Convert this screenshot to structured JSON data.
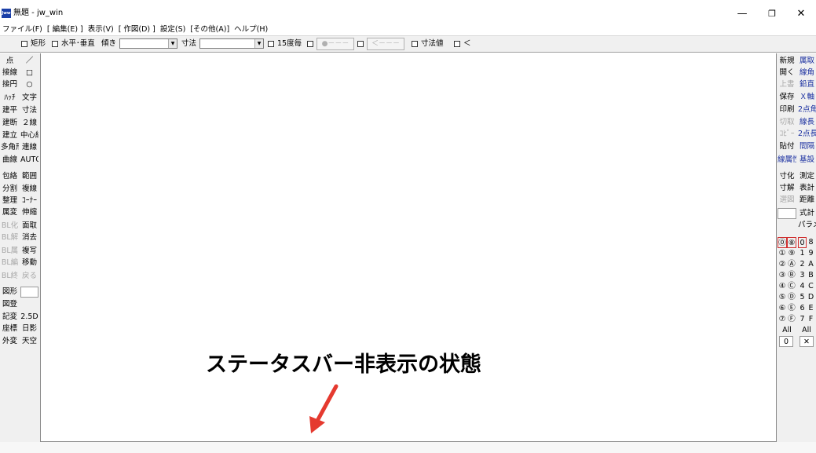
{
  "window": {
    "app_icon_text": "Jww",
    "title": "無題 - jw_win",
    "controls": {
      "minimize": "—",
      "maximize": "❐",
      "close": "✕"
    }
  },
  "menu": [
    "ファイル(F)",
    "[ 編集(E) ]",
    "表示(V)",
    "[ 作図(D) ]",
    "設定(S)",
    "[その他(A)]",
    "ヘルプ(H)"
  ],
  "toolbar": {
    "rect": "矩形",
    "horiz_vert": "水平･垂直",
    "angle_label": "傾き",
    "angle_value": "",
    "dim_label": "寸法",
    "dim_value": "",
    "deg15": "15度毎",
    "btn1": "●－－－",
    "btn2": "＜－－－",
    "dim_value_label": "寸法値",
    "last": "＜"
  },
  "left_tools": [
    [
      "点",
      "／"
    ],
    [
      "接線",
      "□"
    ],
    [
      "接円",
      "○"
    ],
    [
      "ﾊｯﾁ",
      "文字"
    ],
    [
      "建平",
      "寸法"
    ],
    [
      "建断",
      "２線"
    ],
    [
      "建立",
      "中心線"
    ],
    [
      "多角形",
      "連線"
    ],
    [
      "曲線",
      "AUTO"
    ],
    [
      "包絡",
      "範囲"
    ],
    [
      "分割",
      "複線"
    ],
    [
      "整理",
      "ｺｰﾅｰ"
    ],
    [
      "属変",
      "伸縮"
    ],
    [
      "BL化",
      "面取"
    ],
    [
      "BL解",
      "消去"
    ],
    [
      "BL属",
      "複写"
    ],
    [
      "BL編",
      "移動"
    ],
    [
      "BL終",
      "戻る"
    ],
    [
      "図形",
      ""
    ],
    [
      "図登",
      ""
    ],
    [
      "記変",
      "2.5D"
    ],
    [
      "座標",
      "日影"
    ],
    [
      "外変",
      "天空"
    ]
  ],
  "right_tools": [
    [
      "新規",
      "属取"
    ],
    [
      "開く",
      "線角"
    ],
    [
      "上書",
      "鉛直"
    ],
    [
      "保存",
      "Ｘ軸"
    ],
    [
      "印刷",
      "2点角"
    ],
    [
      "切取",
      "線長"
    ],
    [
      "ｺﾋﾟｰ",
      "2点長"
    ],
    [
      "貼付",
      "間隔"
    ],
    [
      "線属性",
      "基設"
    ],
    [
      "寸化",
      "測定"
    ],
    [
      "寸解",
      "表計"
    ],
    [
      "選図",
      "距離"
    ],
    [
      "",
      "式計"
    ],
    [
      "",
      "パラメ"
    ]
  ],
  "layers": {
    "left_pairs": [
      [
        "⓪",
        "⑧"
      ],
      [
        "①",
        "⑨"
      ],
      [
        "②",
        "Ⓐ"
      ],
      [
        "③",
        "Ⓑ"
      ],
      [
        "④",
        "Ⓒ"
      ],
      [
        "⑤",
        "Ⓓ"
      ],
      [
        "⑥",
        "Ⓔ"
      ],
      [
        "⑦",
        "Ⓕ"
      ]
    ],
    "right_pairs": [
      [
        "0",
        "8"
      ],
      [
        "1",
        "9"
      ],
      [
        "2",
        "A"
      ],
      [
        "3",
        "B"
      ],
      [
        "4",
        "C"
      ],
      [
        "5",
        "D"
      ],
      [
        "6",
        "E"
      ],
      [
        "7",
        "F"
      ]
    ],
    "all_left": "All",
    "all_right": "All",
    "zero": "0",
    "cross": "✕"
  },
  "annotation": {
    "text": "ステータスバー非表示の状態",
    "arrow_color": "#e53a2f"
  }
}
